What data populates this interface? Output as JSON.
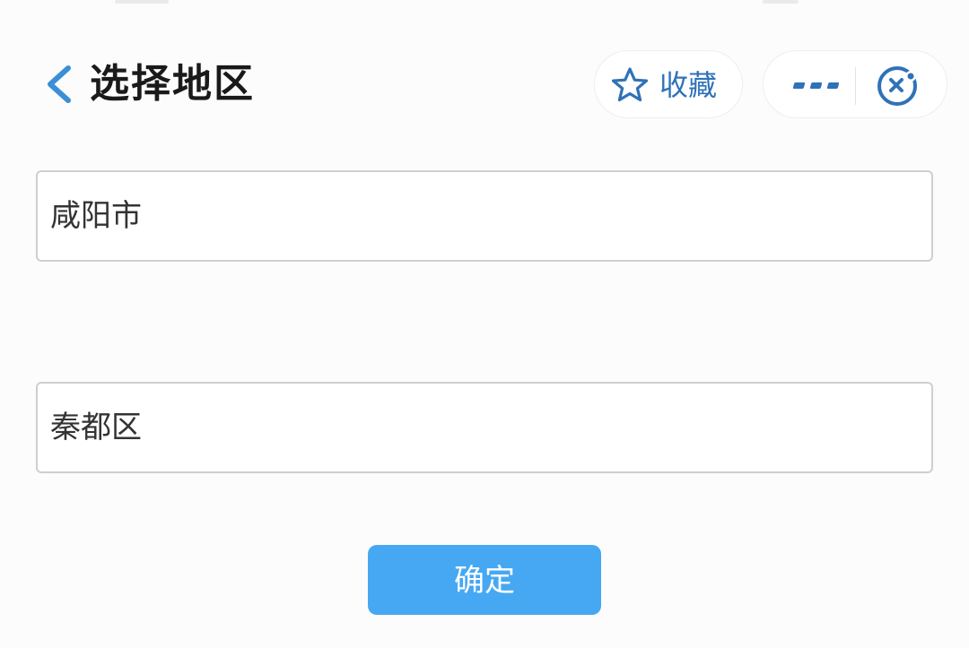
{
  "header": {
    "title": "选择地区",
    "favorite_label": "收藏",
    "back_icon": "chevron-left-icon",
    "favorite_icon": "star-icon",
    "more_icon": "more-icon",
    "close_icon": "close-target-icon"
  },
  "form": {
    "city": {
      "value": "咸阳市"
    },
    "district": {
      "value": "秦都区"
    },
    "confirm_label": "确定"
  },
  "colors": {
    "accent": "#2f72b8",
    "button": "#46a8f2",
    "back_arrow": "#3a8fd6",
    "title": "#1a1a1a"
  }
}
